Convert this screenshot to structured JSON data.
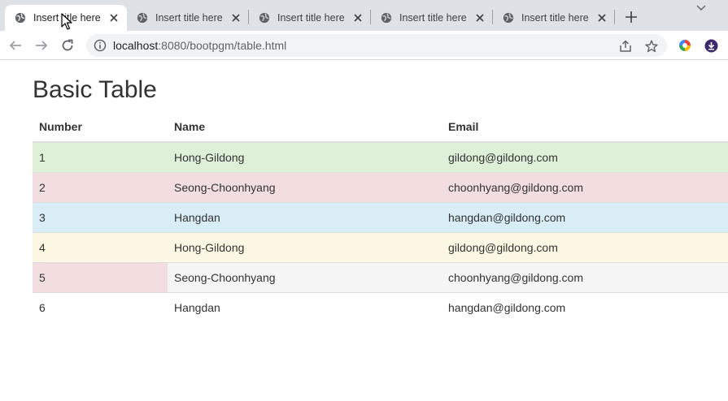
{
  "browser": {
    "tabs": [
      {
        "title": "Insert title here",
        "active": true
      },
      {
        "title": "Insert title here",
        "active": false
      },
      {
        "title": "Insert title here",
        "active": false
      },
      {
        "title": "Insert title here",
        "active": false
      },
      {
        "title": "Insert title here",
        "active": false
      }
    ],
    "address": {
      "host": "localhost",
      "rest": ":8080/bootpgm/table.html"
    },
    "icons": {
      "favicon": "globe-icon",
      "close": "close-icon",
      "new_tab": "plus-icon",
      "tab_search": "chevron-down-icon",
      "back": "arrow-left-icon",
      "forward": "arrow-right-icon",
      "reload": "reload-icon",
      "site_info": "info-icon",
      "share": "share-icon",
      "bookmark": "star-icon",
      "extension": "color-extension-icon",
      "download": "download-icon"
    }
  },
  "page": {
    "title": "Basic Table",
    "table": {
      "headers": [
        "Number",
        "Name",
        "Email"
      ],
      "rows": [
        {
          "number": "1",
          "name": "Hong-Gildong",
          "email": "gildong@gildong.com",
          "style": "success"
        },
        {
          "number": "2",
          "name": "Seong-Choonhyang",
          "email": "choonhyang@gildong.com",
          "style": "danger"
        },
        {
          "number": "3",
          "name": "Hangdan",
          "email": "hangdan@gildong.com",
          "style": "info"
        },
        {
          "number": "4",
          "name": "Hong-Gildong",
          "email": "gildong@gildong.com",
          "style": "warning"
        },
        {
          "number": "5",
          "name": "Seong-Choonhyang",
          "email": "choonhyang@gildong.com",
          "style": "active, first cell danger"
        },
        {
          "number": "6",
          "name": "Hangdan",
          "email": "hangdan@gildong.com",
          "style": "default"
        }
      ]
    }
  },
  "colors": {
    "success": "#dff0d8",
    "danger": "#f2dede",
    "info": "#d9edf7",
    "warning": "#fcf8e3",
    "active": "#f5f5f5",
    "tabstrip": "#dee1e6"
  }
}
